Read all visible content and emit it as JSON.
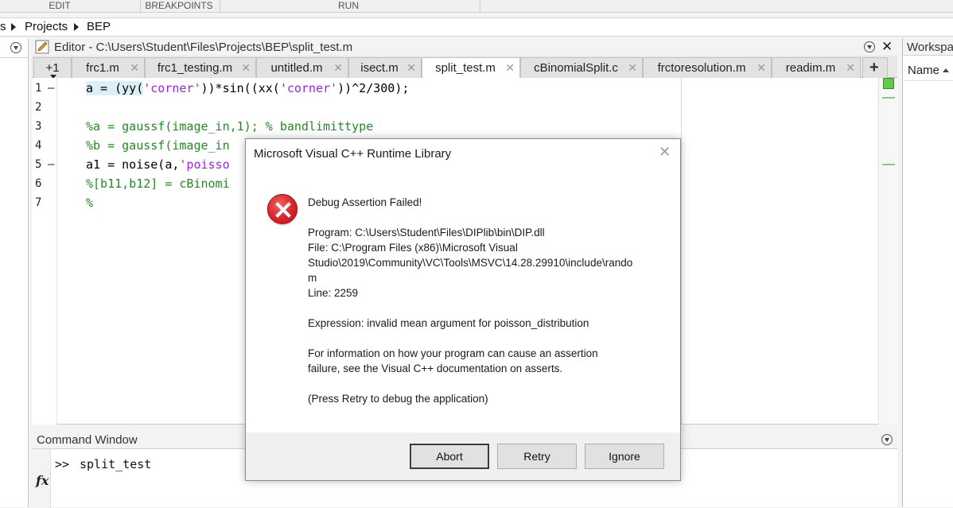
{
  "toolstrip": {
    "sections": [
      "EDIT",
      "BREAKPOINTS",
      "RUN"
    ]
  },
  "address": {
    "prefix": "s",
    "crumbs": [
      "Projects",
      "BEP"
    ]
  },
  "editor": {
    "title": "Editor - C:\\Users\\Student\\Files\\Projects\\BEP\\split_test.m",
    "tab_overflow": "+1",
    "tabs": [
      {
        "label": "frc1.m"
      },
      {
        "label": "frc1_testing.m"
      },
      {
        "label": "untitled.m"
      },
      {
        "label": "isect.m"
      },
      {
        "label": "split_test.m",
        "active": true
      },
      {
        "label": "cBinomialSplit.c"
      },
      {
        "label": "frctoresolution.m"
      },
      {
        "label": "readim.m"
      }
    ],
    "line_numbers": [
      "1",
      "2",
      "3",
      "4",
      "5",
      "6",
      "7"
    ],
    "code": {
      "l1_a": "a = (yy(",
      "l1_s1": "'corner'",
      "l1_b": "))*sin((xx(",
      "l1_s2": "'corner'",
      "l1_c": "))^2/300);",
      "l3": "%a = gaussf(image_in,1); % bandlimittype",
      "l4": "%b = gaussf(image_in",
      "l5_a": "a1 = noise(a,",
      "l5_s": "'poisso",
      "l6": "%[b11,b12] = cBinomi",
      "l7": "%"
    }
  },
  "command_window": {
    "title": "Command Window",
    "prompt": ">>",
    "command": "split_test",
    "fx": "fx"
  },
  "workspace": {
    "title": "Workspa",
    "column": "Name"
  },
  "dialog": {
    "title": "Microsoft Visual C++ Runtime Library",
    "heading": "Debug Assertion Failed!",
    "program": "Program: C:\\Users\\Student\\Files\\DIPlib\\bin\\DIP.dll",
    "file_1": "File: C:\\Program Files (x86)\\Microsoft Visual",
    "file_2": "Studio\\2019\\Community\\VC\\Tools\\MSVC\\14.28.29910\\include\\rando",
    "file_3": "m",
    "line": "Line: 2259",
    "expression": "Expression: invalid mean argument for poisson_distribution",
    "info_1": "For information on how your program can cause an assertion",
    "info_2": "failure, see the Visual C++ documentation on asserts.",
    "hint": "(Press Retry to debug the application)",
    "buttons": {
      "abort": "Abort",
      "retry": "Retry",
      "ignore": "Ignore"
    }
  }
}
